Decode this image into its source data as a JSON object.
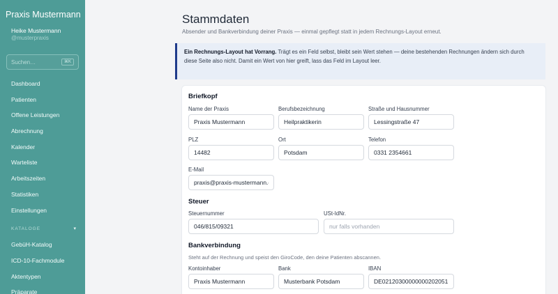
{
  "sidebar": {
    "brand": "Praxis Mustermann",
    "user_name": "Heike Mustermann",
    "user_handle": "@musterpraxis",
    "search_placeholder": "Suchen…",
    "search_shortcut": "⌘K",
    "items": [
      {
        "label": "Dashboard"
      },
      {
        "label": "Patienten"
      },
      {
        "label": "Offene Leistungen"
      },
      {
        "label": "Abrechnung"
      },
      {
        "label": "Kalender"
      },
      {
        "label": "Warteliste"
      },
      {
        "label": "Arbeitszeiten"
      },
      {
        "label": "Statistiken"
      },
      {
        "label": "Einstellungen"
      }
    ],
    "catalog_section": {
      "label": "Kataloge",
      "caret": "▾"
    },
    "catalog_items": [
      {
        "label": "GebüH-Katalog"
      },
      {
        "label": "ICD-10-Fachmodule"
      },
      {
        "label": "Aktentypen"
      },
      {
        "label": "Präparate"
      }
    ]
  },
  "page": {
    "title": "Stammdaten",
    "subtitle": "Absender und Bankverbindung deiner Praxis — einmal gepflegt statt in jedem Rechnungs-Layout erneut."
  },
  "notice": {
    "bold": "Ein Rechnungs-Layout hat Vorrang.",
    "text": " Trägt es ein Feld selbst, bleibt sein Wert stehen — deine bestehenden Rechnungen ändern sich durch diese Seite also nicht. Damit ein Wert von hier greift, lass das Feld im Layout leer."
  },
  "form": {
    "briefkopf": {
      "title": "Briefkopf",
      "name_label": "Name der Praxis",
      "name_value": "Praxis Mustermann",
      "beruf_label": "Berufsbezeichnung",
      "beruf_value": "Heilpraktikerin",
      "strasse_label": "Straße und Hausnummer",
      "strasse_value": "Lessingstraße 47",
      "plz_label": "PLZ",
      "plz_value": "14482",
      "ort_label": "Ort",
      "ort_value": "Potsdam",
      "telefon_label": "Telefon",
      "telefon_value": "0331 2354661",
      "email_label": "E-Mail",
      "email_value": "praxis@praxis-mustermann.de"
    },
    "steuer": {
      "title": "Steuer",
      "steuernummer_label": "Steuernummer",
      "steuernummer_value": "046/815/09321",
      "ustid_label": "USt-IdNr.",
      "ustid_placeholder": "nur falls vorhanden"
    },
    "bank": {
      "title": "Bankverbindung",
      "help": "Steht auf der Rechnung und speist den GiroCode, den deine Patienten abscannen.",
      "inhaber_label": "Kontoinhaber",
      "inhaber_value": "Praxis Mustermann",
      "bank_label": "Bank",
      "bank_value": "Musterbank Potsdam",
      "iban_label": "IBAN",
      "iban_value": "DE02120300000000202051"
    }
  }
}
